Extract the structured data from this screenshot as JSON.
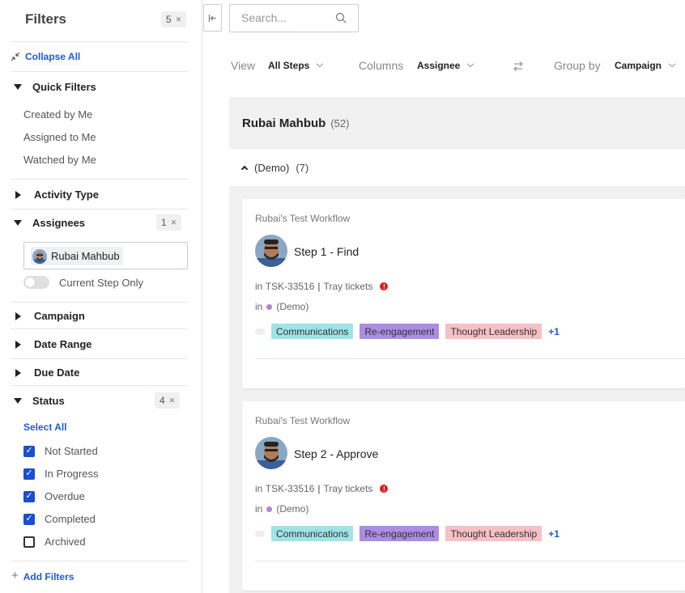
{
  "sidebar": {
    "title": "Filters",
    "filter_count": "5",
    "collapse_all": "Collapse All",
    "quick_filters": {
      "title": "Quick Filters",
      "items": [
        "Created by Me",
        "Assigned to Me",
        "Watched by Me"
      ]
    },
    "activity_type": "Activity Type",
    "assignees": {
      "title": "Assignees",
      "count": "1",
      "selected": "Rubai Mahbub",
      "toggle_label": "Current Step Only"
    },
    "campaign": "Campaign",
    "date_range": "Date Range",
    "due_date": "Due Date",
    "status": {
      "title": "Status",
      "count": "4",
      "select_all": "Select All",
      "options": [
        {
          "label": "Not Started",
          "checked": true
        },
        {
          "label": "In Progress",
          "checked": true
        },
        {
          "label": "Overdue",
          "checked": true
        },
        {
          "label": "Completed",
          "checked": true
        },
        {
          "label": "Archived",
          "checked": false
        }
      ]
    },
    "add_filters": "Add Filters"
  },
  "toolbar": {
    "search_placeholder": "Search...",
    "view_label": "View",
    "view_value": "All Steps",
    "columns_label": "Columns",
    "columns_value": "Assignee",
    "group_by_label": "Group by",
    "group_by_value": "Campaign"
  },
  "main": {
    "group_name": "Rubai Mahbub",
    "group_count": "(52)",
    "subgroup_name": "(Demo)",
    "subgroup_count": "(7)",
    "cards": [
      {
        "workflow": "Rubai's Test Workflow",
        "step": "Step 1 - Find",
        "in1": "in",
        "task_id": "TSK-33516",
        "sep": "|",
        "task_name": "Tray tickets",
        "in2": "in",
        "campaign": "(Demo)",
        "tags": [
          "Communications",
          "Re-engagement",
          "Thought Leadership"
        ],
        "more": "+1"
      },
      {
        "workflow": "Rubai's Test Workflow",
        "step": "Step 2 - Approve",
        "in1": "in",
        "task_id": "TSK-33516",
        "sep": "|",
        "task_name": "Tray tickets",
        "in2": "in",
        "campaign": "(Demo)",
        "tags": [
          "Communications",
          "Re-engagement",
          "Thought Leadership"
        ],
        "more": "+1"
      }
    ]
  },
  "colors": {
    "accent": "#1d5bd6",
    "checkbox": "#1a4fd0",
    "tag_communications": "#9ee3e5",
    "tag_reengagement": "#ab8de3",
    "tag_thought_leadership": "#f6c0c6",
    "alert": "#e01e1e",
    "campaign_dot": "#b583d4"
  }
}
